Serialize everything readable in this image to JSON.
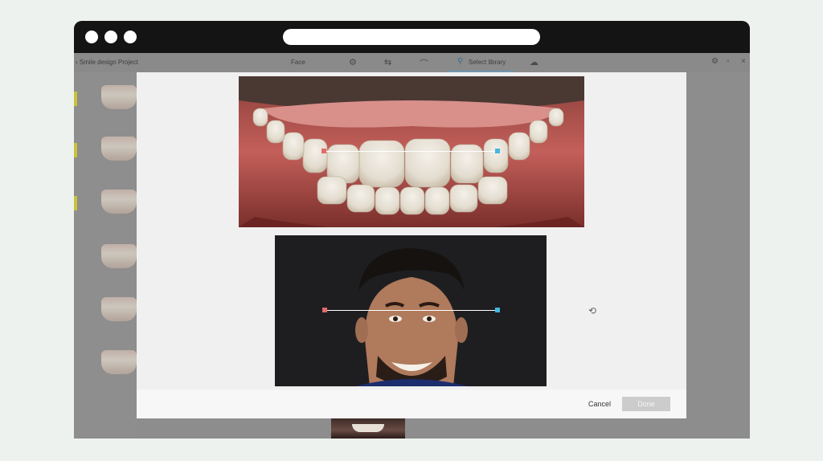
{
  "browser": {
    "dots": [
      "dot-1",
      "dot-2",
      "dot-3"
    ],
    "url": ""
  },
  "appbar": {
    "back_label": "Smile design Project",
    "center_label": "Face",
    "library_tab_label": "Select library",
    "icons": [
      "adjust-icon",
      "ruler-icon",
      "arch-icon",
      "search-icon",
      "cloud-icon",
      "gear-icon",
      "minimize-icon",
      "close-icon"
    ]
  },
  "sidebar": {
    "thumbnails": [
      1,
      2,
      3,
      4,
      5,
      6
    ]
  },
  "modal": {
    "cancel_label": "Cancel",
    "done_label": "Done",
    "rotate_icon": "rotate-icon"
  },
  "colors": {
    "point_left": "#e46a6a",
    "point_right": "#45b7dd",
    "done_disabled": "#cccccc"
  }
}
